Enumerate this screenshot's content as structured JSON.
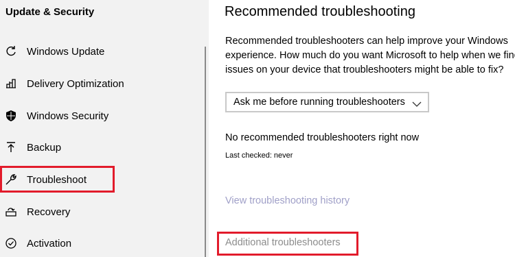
{
  "sidebar": {
    "title": "Update & Security",
    "items": [
      {
        "label": "Windows Update",
        "icon": "refresh-icon"
      },
      {
        "label": "Delivery Optimization",
        "icon": "delivery-optimization-icon"
      },
      {
        "label": "Windows Security",
        "icon": "shield-icon"
      },
      {
        "label": "Backup",
        "icon": "backup-arrow-icon"
      },
      {
        "label": "Troubleshoot",
        "icon": "wrench-icon",
        "selected": true
      },
      {
        "label": "Recovery",
        "icon": "recovery-icon"
      },
      {
        "label": "Activation",
        "icon": "activation-check-icon"
      }
    ]
  },
  "main": {
    "title": "Recommended troubleshooting",
    "description": "Recommended troubleshooters can help improve your Windows experience. How much do you want Microsoft to help when we find issues on your device that troubleshooters might be able to fix?",
    "dropdown": {
      "value": "Ask me before running troubleshooters"
    },
    "status": "No recommended troubleshooters right now",
    "last_checked": "Last checked: never",
    "history_link": "View troubleshooting history",
    "additional_link": "Additional troubleshooters"
  },
  "colors": {
    "highlight": "#e21b2b",
    "sidebar_bg": "#f2f2f2",
    "link_history": "#a0a0c8",
    "link_additional": "#8c8c8c"
  }
}
